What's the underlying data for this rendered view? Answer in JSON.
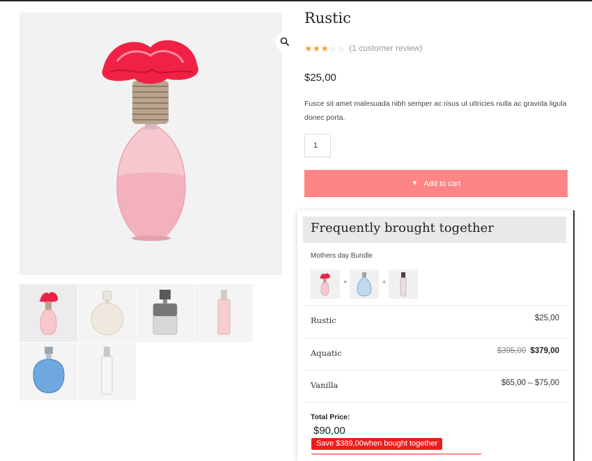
{
  "product": {
    "title": "Rustic",
    "rating": 3,
    "rating_max": 5,
    "review_text": "(1 customer review)",
    "price": "$25,00",
    "description": "Fusce sit amet malesuada nibh semper ac risus ut ultricies nulla ac gravida ligula donec porta.",
    "quantity": "1",
    "add_to_cart_label": "Add to cart"
  },
  "gallery": {
    "zoom_icon": "search-icon",
    "thumbs": [
      "red-flower-bottle",
      "round-pearl-bottle",
      "black-cap-bottle",
      "pink-slim-bottle",
      "blue-round-bottle",
      "clear-slim-bottle"
    ]
  },
  "fbt": {
    "title": "Frequently brought together",
    "bundle_name": "Mothers day Bundle",
    "items": [
      {
        "name": "Rustic",
        "price": "$25,00"
      },
      {
        "name": "Aquatic",
        "old_price": "$395,00",
        "price": "$379,00"
      },
      {
        "name": "Vanilla",
        "price": "$65,00 – $75,00"
      }
    ],
    "total_label": "Total Price:",
    "total_value": "$90,00",
    "save_text": "Save $389,00when bought together"
  },
  "colors": {
    "accent": "#fd8585",
    "star": "#f0a33a",
    "save_badge": "#ee1c1c"
  }
}
